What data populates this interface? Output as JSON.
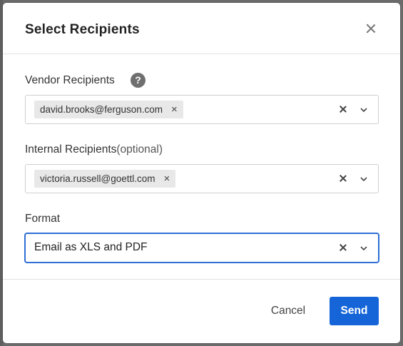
{
  "dialog": {
    "title": "Select Recipients",
    "close_icon": "close-icon"
  },
  "vendor": {
    "label": "Vendor Recipients",
    "help_icon": "question-circle-icon",
    "help_glyph": "?",
    "chips": [
      "david.brooks@ferguson.com"
    ]
  },
  "internal": {
    "label": "Internal Recipients",
    "optional": "(optional)",
    "chips": [
      "victoria.russell@goettl.com"
    ]
  },
  "format": {
    "label": "Format",
    "value": "Email as XLS and PDF"
  },
  "footer": {
    "cancel_label": "Cancel",
    "send_label": "Send"
  },
  "colors": {
    "primary": "#1565d8",
    "focus": "#2f6fd6",
    "chip_bg": "#e8e8e8"
  }
}
